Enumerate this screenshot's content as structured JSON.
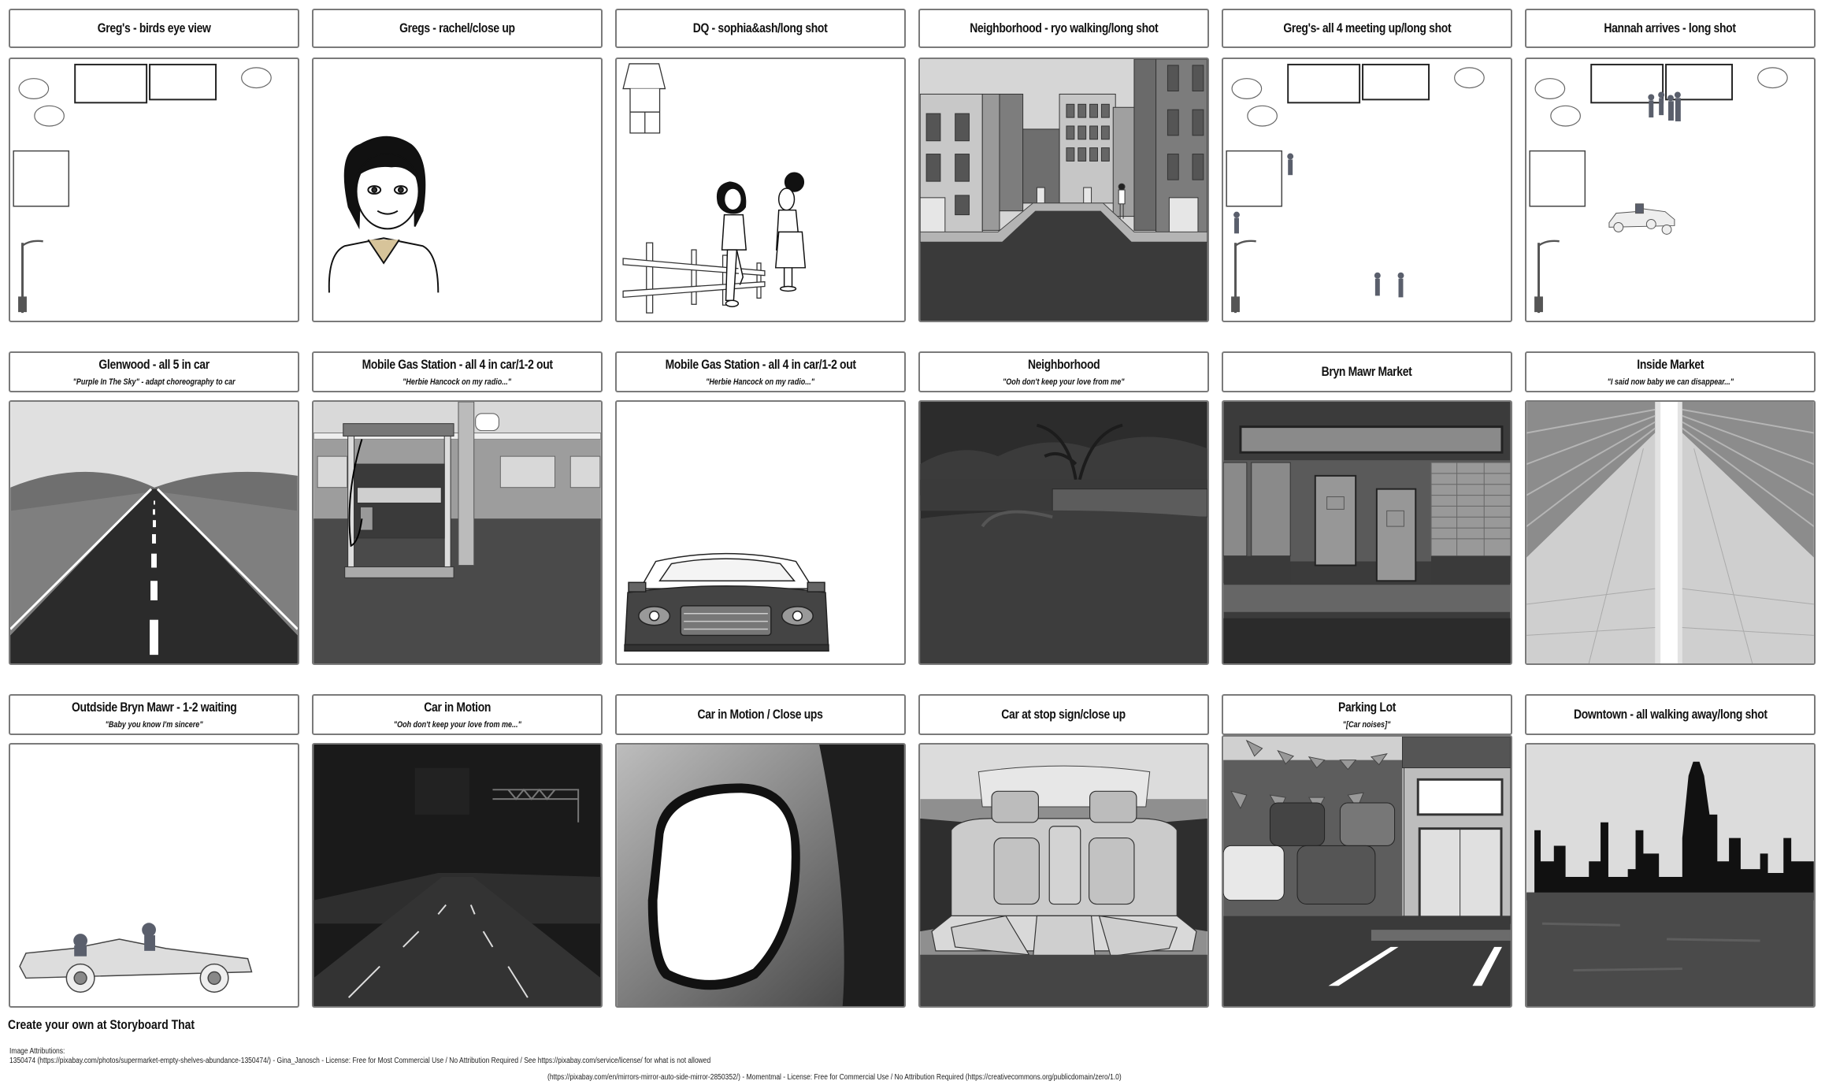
{
  "storyboard": {
    "panels": [
      {
        "title": "Greg's - birds eye view",
        "caption": "",
        "scene": "overhead-map"
      },
      {
        "title": "Gregs - rachel/close up",
        "caption": "",
        "scene": "character-close-up"
      },
      {
        "title": "DQ - sophia&ash/long shot",
        "caption": "",
        "scene": "two-characters-fence"
      },
      {
        "title": "Neighborhood - ryo walking/long shot",
        "caption": "",
        "scene": "city-street"
      },
      {
        "title": "Greg's- all 4 meeting up/long shot",
        "caption": "",
        "scene": "overhead-map-figures"
      },
      {
        "title": "Hannah arrives - long shot",
        "caption": "",
        "scene": "overhead-map-car"
      },
      {
        "title": "Glenwood - all 5 in car",
        "caption": "\"Purple In The Sky\" - adapt choreography to car",
        "scene": "highway"
      },
      {
        "title": "Mobile Gas Station - all 4 in car/1-2 out",
        "caption": "\"Herbie Hancock on my radio...\"",
        "scene": "gas-station"
      },
      {
        "title": "Mobile Gas Station - all 4 in car/1-2 out",
        "caption": "\"Herbie Hancock on my radio...\"",
        "scene": "car-front"
      },
      {
        "title": "Neighborhood",
        "caption": "\"Ooh don't keep your love from me\"",
        "scene": "night-neighborhood"
      },
      {
        "title": "Bryn Mawr Market",
        "caption": "",
        "scene": "storefront"
      },
      {
        "title": "Inside Market",
        "caption": "\"I said now baby we can disappear...\"",
        "scene": "market-aisles"
      },
      {
        "title": "Outdside Bryn Mawr - 1-2 waiting",
        "caption": "\"Baby you know I'm sincere\"",
        "scene": "convertible"
      },
      {
        "title": "Car in Motion",
        "caption": "\"Ooh don't keep your love from me...\"",
        "scene": "night-highway"
      },
      {
        "title": "Car in Motion / Close ups",
        "caption": "",
        "scene": "side-mirror"
      },
      {
        "title": "Car at stop sign/close up",
        "caption": "",
        "scene": "car-interior"
      },
      {
        "title": "Parking Lot",
        "caption": "\"[Car noises]\"",
        "scene": "parking-lot"
      },
      {
        "title": "Downtown - all walking away/long shot",
        "caption": "",
        "scene": "skyline"
      }
    ]
  },
  "footer": {
    "cta": "Create your own at Storyboard That",
    "attributions_label": "Image Attributions:",
    "attributions": [
      "1350474 (https://pixabay.com/photos/supermarket-empty-shelves-abundance-1350474/) - Gina_Janosch - License: Free for Most Commercial Use / No Attribution Required / See https://pixabay.com/service/license/ for what is not allowed",
      "(https://pixabay.com/en/mirrors-mirror-auto-side-mirror-2850352/) - Momentmal - License: Free for Commercial Use / No Attribution Required (https://creativecommons.org/publicdomain/zero/1.0)"
    ]
  }
}
